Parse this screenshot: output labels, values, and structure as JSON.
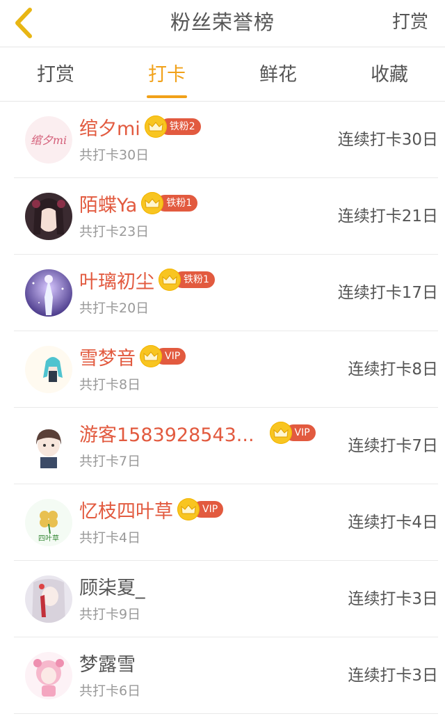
{
  "header": {
    "back_icon": "chevron-left-icon",
    "title": "粉丝荣誉榜",
    "action": "打赏"
  },
  "tabs": [
    {
      "label": "打赏",
      "active": false
    },
    {
      "label": "打卡",
      "active": true
    },
    {
      "label": "鲜花",
      "active": false
    },
    {
      "label": "收藏",
      "active": false
    }
  ],
  "fans": [
    {
      "name": "绾夕mi",
      "badge": "铁粉2",
      "total": "共打卡30日",
      "streak": "连续打卡30日",
      "highlight": true
    },
    {
      "name": "陌蝶Ya",
      "badge": "铁粉1",
      "total": "共打卡23日",
      "streak": "连续打卡21日",
      "highlight": true
    },
    {
      "name": "叶璃初尘",
      "badge": "铁粉1",
      "total": "共打卡20日",
      "streak": "连续打卡17日",
      "highlight": true
    },
    {
      "name": "雪梦音",
      "badge": "VIP",
      "total": "共打卡8日",
      "streak": "连续打卡8日",
      "highlight": true
    },
    {
      "name": "游客1583928543...",
      "badge": "VIP",
      "total": "共打卡7日",
      "streak": "连续打卡7日",
      "highlight": true
    },
    {
      "name": "忆枝四叶草",
      "badge": "VIP",
      "total": "共打卡4日",
      "streak": "连续打卡4日",
      "highlight": true
    },
    {
      "name": "顾柒夏_",
      "badge": "",
      "total": "共打卡9日",
      "streak": "连续打卡3日",
      "highlight": false
    },
    {
      "name": "梦露雪",
      "badge": "",
      "total": "共打卡6日",
      "streak": "连续打卡3日",
      "highlight": false
    }
  ],
  "colors": {
    "accent": "#f1a119",
    "name_red": "#e25a3f",
    "crown_gold": "#f8c521"
  }
}
